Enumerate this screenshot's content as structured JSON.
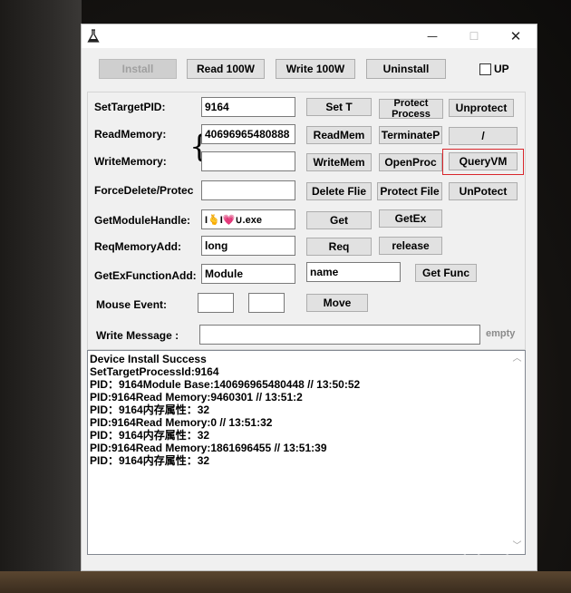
{
  "window": {
    "minimize_glyph": "—",
    "maximize_glyph": "☐",
    "close_glyph": "✕"
  },
  "toolbar": {
    "install": "Install",
    "read100w": "Read 100W",
    "write100w": "Write 100W",
    "uninstall": "Uninstall",
    "up_label": "UP"
  },
  "rows": {
    "set_target_pid": {
      "label": "SetTargetPID:",
      "value": "9164",
      "set_t": "Set T",
      "protect_process": "Protect\nProcess",
      "unprotect": "Unprotect"
    },
    "read_memory": {
      "label": "ReadMemory:",
      "value": "40696965480888",
      "readmem": "ReadMem",
      "terminate": "TerminateP",
      "slash": "/"
    },
    "write_memory": {
      "label": "WriteMemory:",
      "value": "",
      "writemem": "WriteMem",
      "openproc": "OpenProc",
      "queryvm": "QueryVM"
    },
    "force_delete": {
      "label": "ForceDelete/Protec",
      "value": "",
      "delete_file": "Delete Flie",
      "protect_file": "Protect File",
      "unpotect": "UnPotect"
    },
    "get_module_handle": {
      "label": "GetModuleHandle:",
      "value": "I🫰I💗∪.exe",
      "get": "Get",
      "getex": "GetEx"
    },
    "req_memory_add": {
      "label": "ReqMemoryAdd:",
      "value": "long",
      "req": "Req",
      "release": "release"
    },
    "get_ex_function_add": {
      "label": "GetExFunctionAdd:",
      "value": "Module",
      "name_value": "name",
      "get_func": "Get Func"
    },
    "mouse_event": {
      "label": "Mouse Event:",
      "x_value": "",
      "y_value": "",
      "move": "Move"
    },
    "write_message": {
      "label": "Write Message :",
      "value": "",
      "placeholder": "empty"
    }
  },
  "log": {
    "lines": [
      "Device Install Success",
      "SetTargetProcessId:9164",
      "PID：9164Module Base:140696965480448  //  13:50:52",
      "PID:9164Read Memory:9460301  //  13:51:2",
      "PID：9164内存属性：32",
      "PID:9164Read Memory:0  //  13:51:32",
      "PID：9164内存属性：32",
      "PID:9164Read Memory:1861696455  //  13:51:39",
      "PID：9164内存属性：32"
    ]
  },
  "watermark": {
    "text": "看雪"
  },
  "icons": {
    "app": "flask-icon",
    "scroll_up": "chevron-up-icon",
    "scroll_down": "chevron-down-icon"
  },
  "colors": {
    "highlight": "#d9262c",
    "window_bg": "#f0f0f0",
    "button_bg": "#e1e1e1"
  }
}
